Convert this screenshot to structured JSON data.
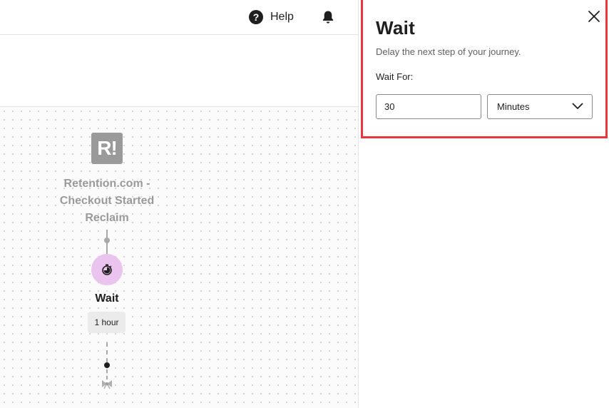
{
  "header": {
    "help_label": "Help",
    "icons": {
      "help": "help-circle-icon",
      "notifications": "bell-icon"
    }
  },
  "canvas": {
    "trigger": {
      "logo_text": "R!",
      "title_lines": [
        "Retention.com -",
        "Checkout Started",
        "Reclaim"
      ]
    },
    "wait_step": {
      "icon": "stopwatch-icon",
      "label": "Wait",
      "duration": "1 hour"
    },
    "end_icon": "bow-icon"
  },
  "panel": {
    "title": "Wait",
    "description": "Delay the next step of your journey.",
    "wait_for_label": "Wait For:",
    "amount_value": "30",
    "unit_selected": "Minutes",
    "close_icon": "close-icon",
    "highlight_color": "#e8373c"
  },
  "colors": {
    "wait_node_bg": "#eac3ef",
    "connector": "#a8a8a8",
    "trigger_gray": "#9a9a9a"
  }
}
